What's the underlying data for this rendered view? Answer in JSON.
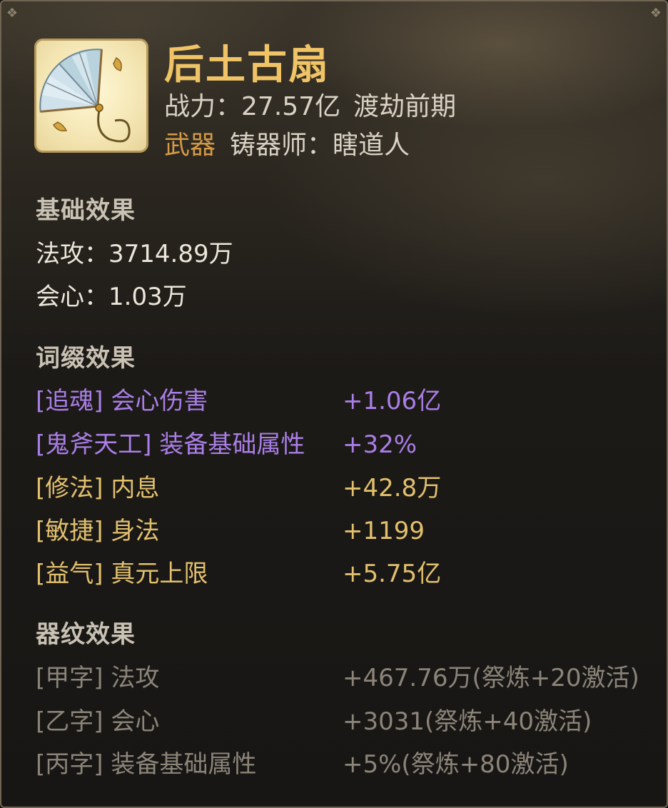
{
  "item": {
    "name": "后土古扇",
    "power_label": "战力：",
    "power_value": "27.57亿",
    "realm": "渡劫前期",
    "type": "武器",
    "crafter_label": "铸器师：",
    "crafter_name": "瞎道人",
    "icon": "folding-fan-icon"
  },
  "base_effects": {
    "title": "基础效果",
    "rows": [
      {
        "text": "法攻：3714.89万"
      },
      {
        "text": "会心：1.03万"
      }
    ]
  },
  "affix_effects": {
    "title": "词缀效果",
    "rows": [
      {
        "name": "[追魂] 会心伤害",
        "value": "+1.06亿",
        "color": "#a97ee6"
      },
      {
        "name": "[鬼斧天工] 装备基础属性",
        "value": "+32%",
        "color": "#a97ee6"
      },
      {
        "name": "[修法] 内息",
        "value": "+42.8万",
        "color": "#e2c06d"
      },
      {
        "name": "[敏捷] 身法",
        "value": "+1199",
        "color": "#e2c06d"
      },
      {
        "name": "[益气] 真元上限",
        "value": "+5.75亿",
        "color": "#e2c06d"
      }
    ]
  },
  "pattern_effects": {
    "title": "器纹效果",
    "rows": [
      {
        "name": "[甲字] 法攻",
        "value": "+467.76万(祭炼+20激活)"
      },
      {
        "name": "[乙字] 会心",
        "value": "+3031(祭炼+40激活)"
      },
      {
        "name": "[丙字] 装备基础属性",
        "value": "+5%(祭炼+80激活)"
      }
    ]
  },
  "colors": {
    "title_gold": "#f0c466",
    "type_orange": "#d59a46",
    "affix_purple": "#a97ee6",
    "affix_gold": "#e2c06d",
    "inactive_gray": "#8b8479"
  }
}
